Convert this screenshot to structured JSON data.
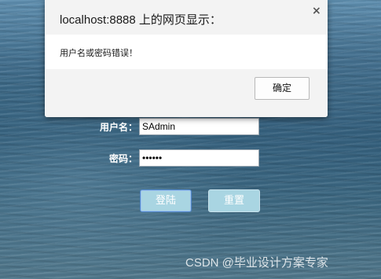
{
  "dialog": {
    "title": "localhost:8888 上的网页显示：",
    "close_symbol": "×",
    "message": "用户名或密码错误！",
    "ok_label": "确定"
  },
  "login": {
    "username_label": "用户名：",
    "username_value": "SAdmin",
    "password_label": "密码：",
    "password_value": "••••••",
    "login_button_label": "登陆",
    "reset_button_label": "重置"
  },
  "watermark": "CSDN @毕业设计方案专家",
  "colors": {
    "button_fill": "#a9d5e2",
    "login_button_border": "#4f86c8",
    "dialog_header_bg": "#f3f3f3"
  },
  "icons": {
    "dialog_close": "close-icon"
  }
}
